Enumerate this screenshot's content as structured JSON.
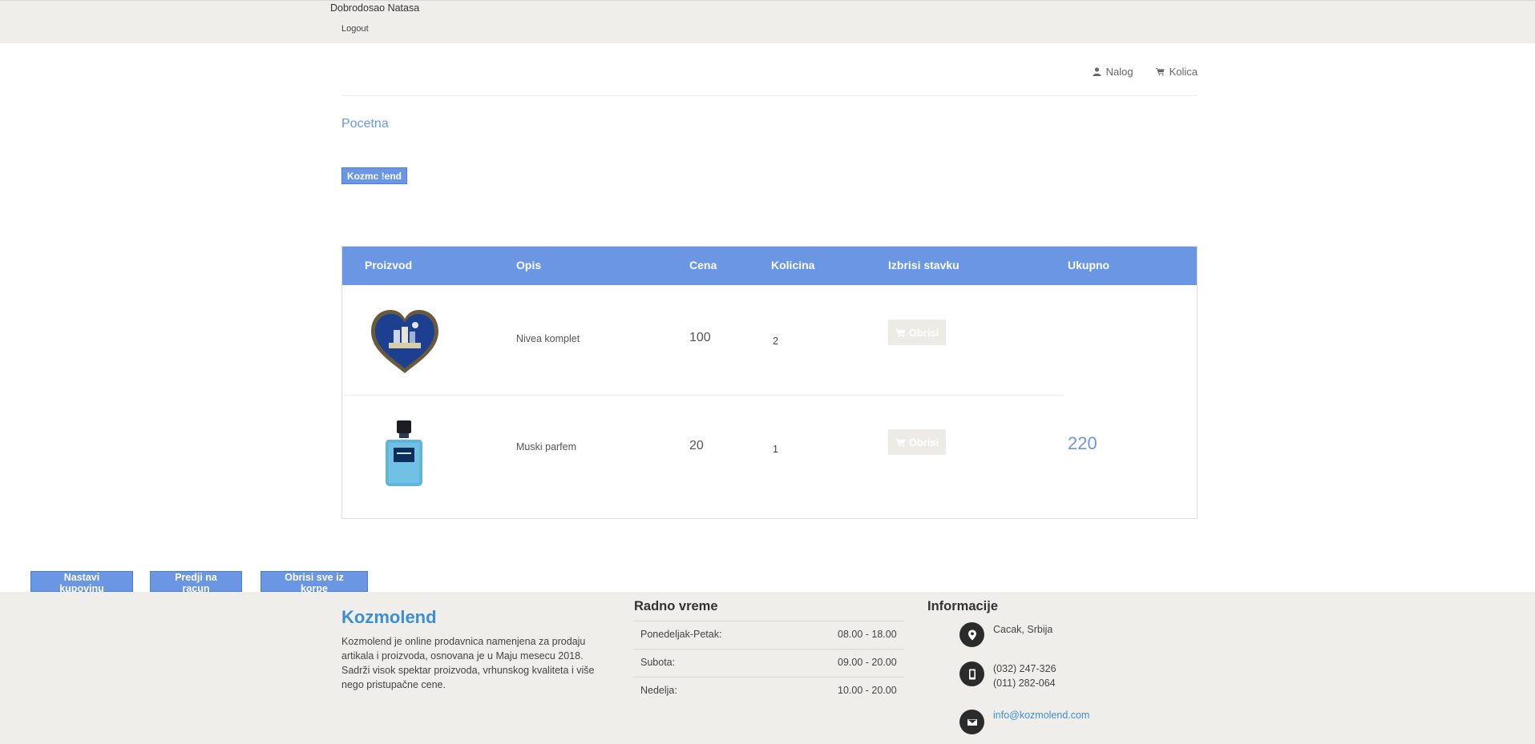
{
  "topbar": {
    "welcome": "Dobrodosao Natasa",
    "logout": "Logout"
  },
  "nav": {
    "account": "Nalog",
    "cart": "Kolica"
  },
  "breadcrumb": "Pocetna",
  "logo_text": "Kozmc !end",
  "cart": {
    "headers": [
      "Proizvod",
      "Opis",
      "Cena",
      "Kolicina",
      "Izbrisi stavku",
      "Ukupno"
    ],
    "rows": [
      {
        "product_icon": "nivea-gift-box-image",
        "description": "Nivea komplet",
        "price": "100",
        "quantity": "2",
        "delete_label": "Obrisi"
      },
      {
        "product_icon": "perfume-bottle-image",
        "description": "Muski parfem",
        "price": "20",
        "quantity": "1",
        "delete_label": "Obrisi"
      }
    ],
    "total": "220"
  },
  "actions": {
    "continue": "Nastavi kupovinu",
    "checkout": "Predji na racun",
    "clear": "Obrisi sve iz korpe"
  },
  "footer": {
    "brand": "Kozmolend",
    "about": "Kozmolend je online prodavnica namenjena za prodaju artikala i proizvoda, osnovana je u Maju mesecu 2018. Sadrži visok spektar proizvoda, vrhunskog kvaliteta i više nego pristupačne cene.",
    "hours_title": "Radno vreme",
    "hours": [
      {
        "day": "Ponedeljak-Petak:",
        "time": "08.00 - 18.00"
      },
      {
        "day": "Subota:",
        "time": "09.00 - 20.00"
      },
      {
        "day": "Nedelja:",
        "time": "10.00 - 20.00"
      }
    ],
    "info_title": "Informacije",
    "address": "Cacak, Srbija",
    "phone1": "(032) 247-326",
    "phone2": "(011) 282-064",
    "email": "info@kozmolend.com"
  },
  "colors": {
    "accent": "#6a96e3",
    "brand": "#3d8fd1",
    "band": "#efeeea"
  }
}
